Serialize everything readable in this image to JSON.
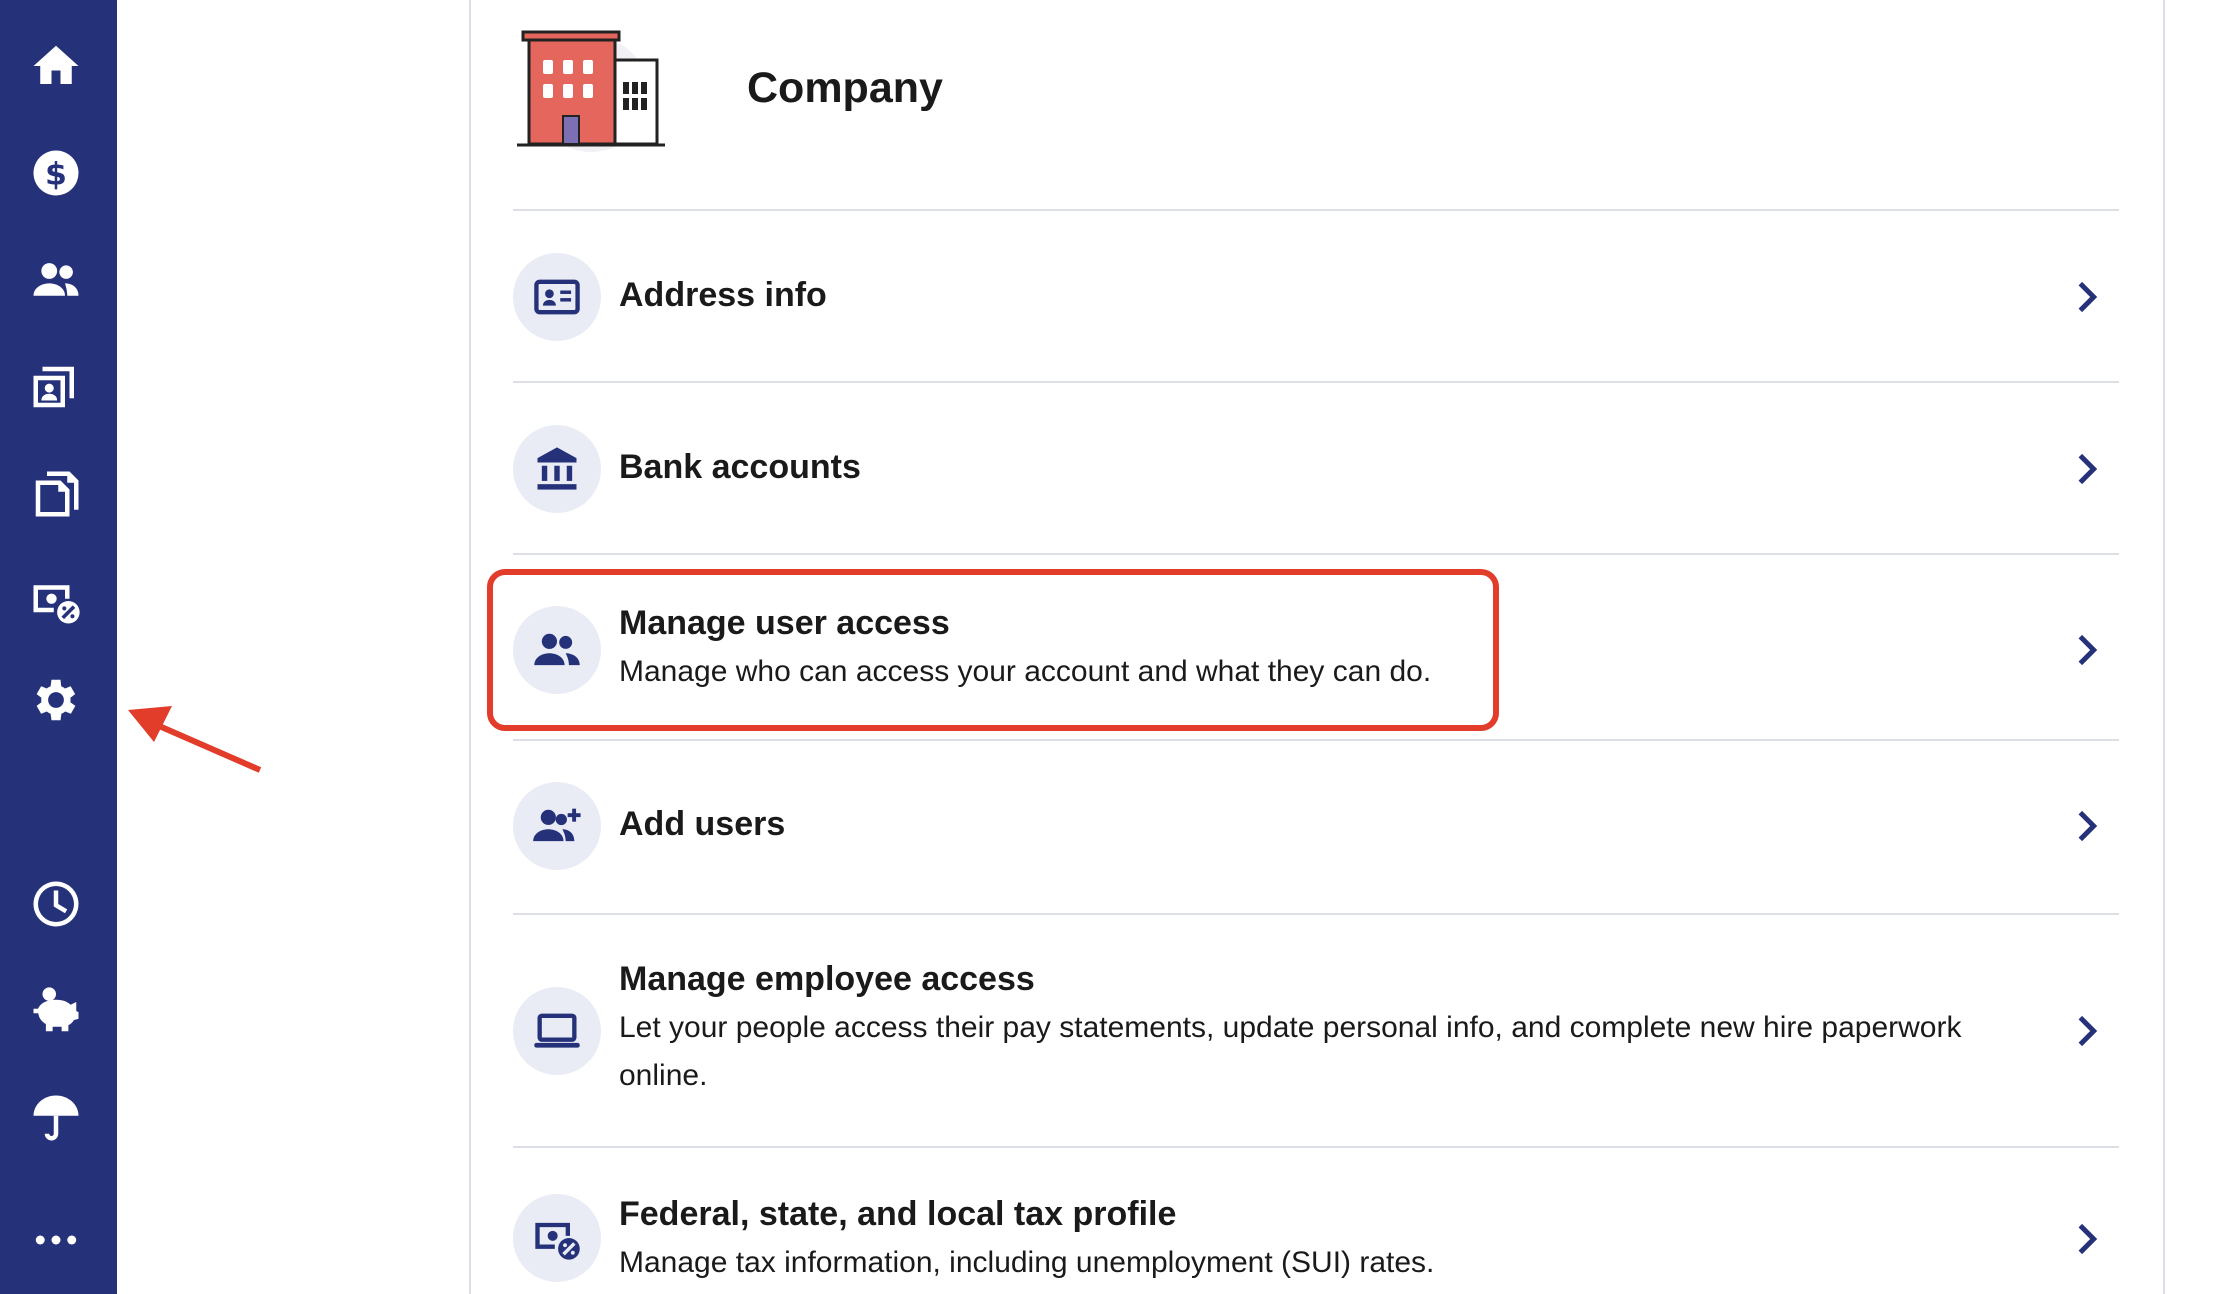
{
  "sidebar": {
    "items": [
      {
        "icon": "home-icon"
      },
      {
        "icon": "dollar-icon"
      },
      {
        "icon": "people-icon"
      },
      {
        "icon": "employee-files-icon"
      },
      {
        "icon": "documents-icon"
      },
      {
        "icon": "tax-icon"
      },
      {
        "icon": "gear-icon"
      },
      {
        "icon": "clock-icon"
      },
      {
        "icon": "piggy-bank-icon"
      },
      {
        "icon": "umbrella-icon"
      },
      {
        "icon": "more-icon"
      }
    ]
  },
  "header": {
    "title": "Company"
  },
  "rows": [
    {
      "title": "Address info",
      "description": "",
      "icon": "address-card-icon"
    },
    {
      "title": "Bank accounts",
      "description": "",
      "icon": "bank-icon"
    },
    {
      "title": "Manage user access",
      "description": "Manage who can access your account and what they can do.",
      "icon": "user-group-icon"
    },
    {
      "title": "Add users",
      "description": "",
      "icon": "add-user-icon"
    },
    {
      "title": "Manage employee access",
      "description": "Let your people access their pay statements, update personal info, and complete new hire paperwork online.",
      "icon": "laptop-icon"
    },
    {
      "title": "Federal, state, and local tax profile",
      "description": "Manage tax information, including unemployment (SUI) rates.",
      "icon": "tax-profile-icon"
    }
  ],
  "colors": {
    "sidebar": "#25327a",
    "accent": "#25327a",
    "icon_circle": "#e9ecf5",
    "highlight": "#e23c2b"
  }
}
